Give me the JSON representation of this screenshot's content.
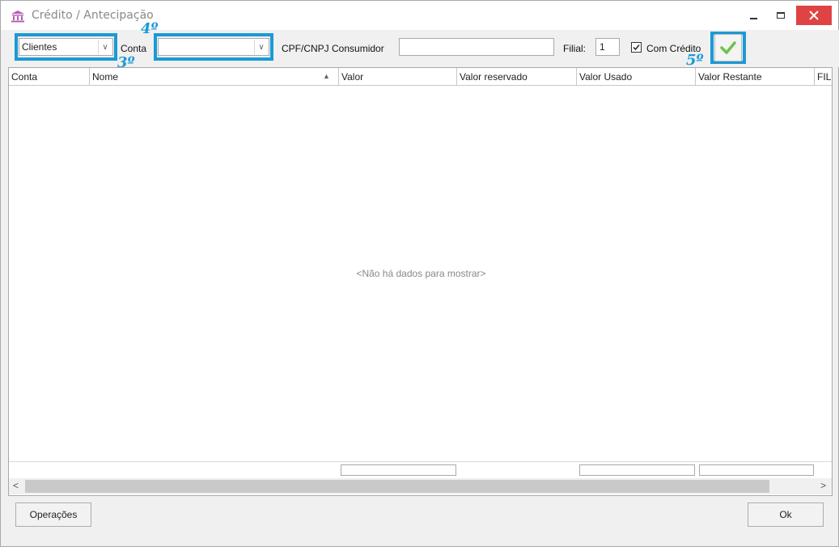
{
  "window": {
    "title": "Crédito / Antecipação",
    "icon": "bank-icon"
  },
  "toolbar": {
    "type_select_value": "Clientes",
    "conta_label": "Conta",
    "conta_select_value": "",
    "cpf_label": "CPF/CNPJ Consumidor",
    "cpf_value": "",
    "filial_label": "Filial:",
    "filial_value": "1",
    "com_credito_label": "Com Crédito",
    "com_credito_checked": true,
    "apply_icon": "checkmark-icon"
  },
  "annotations": {
    "step3": "3º",
    "step4": "4º",
    "step5": "5º",
    "color": "#1a9ad6"
  },
  "grid": {
    "columns": [
      "Conta",
      "Nome",
      "Valor",
      "Valor reservado",
      "Valor Usado",
      "Valor Restante",
      "FIL"
    ],
    "sorted_column": "Nome",
    "empty_message": "<Não há dados para mostrar>"
  },
  "buttons": {
    "operacoes": "Operações",
    "ok": "Ok"
  }
}
